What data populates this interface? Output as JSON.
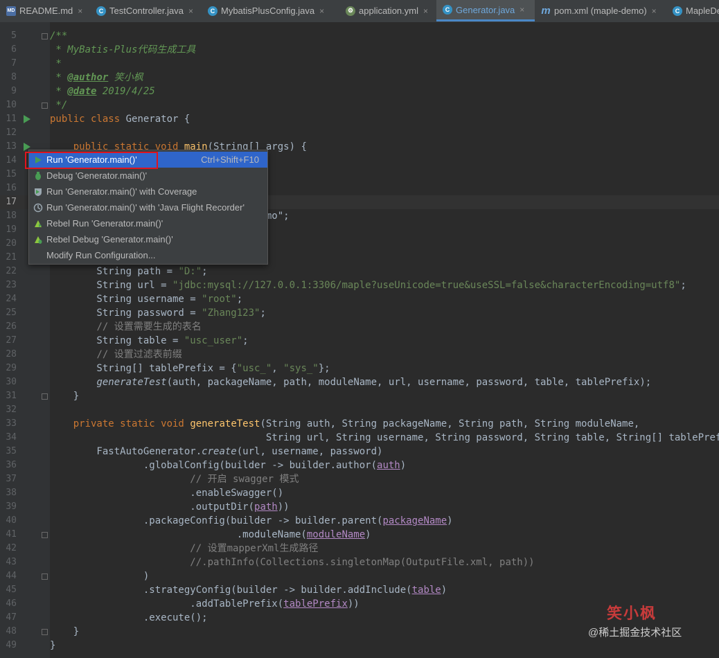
{
  "tabs": [
    {
      "label": "README.md",
      "icon": "markdown-file-icon",
      "active": false
    },
    {
      "label": "TestController.java",
      "icon": "java-class-icon",
      "active": false
    },
    {
      "label": "MybatisPlusConfig.java",
      "icon": "java-class-icon",
      "active": false
    },
    {
      "label": "application.yml",
      "icon": "yaml-file-icon",
      "active": false
    },
    {
      "label": "Generator.java",
      "icon": "java-class-icon",
      "active": true
    },
    {
      "label": "pom.xml (maple-demo)",
      "icon": "maven-file-icon",
      "active": false
    },
    {
      "label": "MapleDe",
      "icon": "java-class-icon",
      "active": false
    }
  ],
  "tab_close_glyph": "×",
  "editor": {
    "current_line": 17,
    "lines": [
      {
        "n": 5,
        "html": "<span class=\"doc\">/**</span>"
      },
      {
        "n": 6,
        "html": "<span class=\"doc\"> * MyBatis-Plus代码生成工具</span>"
      },
      {
        "n": 7,
        "html": "<span class=\"doc\"> *</span>"
      },
      {
        "n": 8,
        "html": "<span class=\"doc\"> * </span><span class=\"doctag\">@author</span><span class=\"doc\"> 笑小枫</span>"
      },
      {
        "n": 9,
        "html": "<span class=\"doc\"> * </span><span class=\"doctag\">@date</span><span class=\"doc\"> 2019/4/25</span>"
      },
      {
        "n": 10,
        "html": "<span class=\"doc\"> */</span>"
      },
      {
        "n": 11,
        "html": "<span class=\"kw\">public class</span> Generator {"
      },
      {
        "n": 12,
        "html": ""
      },
      {
        "n": 13,
        "html": "    <span class=\"kw\">public static void</span> <span class=\"fn\">main</span>(String[] args) {"
      },
      {
        "n": 14,
        "html": ""
      },
      {
        "n": 15,
        "html": ""
      },
      {
        "n": 16,
        "html": ""
      },
      {
        "n": 17,
        "html": ""
      },
      {
        "n": 18,
        "html": "                                  .demo\";"
      },
      {
        "n": 19,
        "html": ""
      },
      {
        "n": 20,
        "html": ""
      },
      {
        "n": 21,
        "html": "        <span class=\"cm\">// 指定输出目录</span>"
      },
      {
        "n": 22,
        "html": "        String path = <span class=\"str\">\"D:\"</span>;"
      },
      {
        "n": 23,
        "html": "        String url = <span class=\"str\">\"jdbc:mysql://127.0.0.1:3306/maple?useUnicode=true&amp;useSSL=false&amp;characterEncoding=utf8\"</span>;"
      },
      {
        "n": 24,
        "html": "        String username = <span class=\"str\">\"root\"</span>;"
      },
      {
        "n": 25,
        "html": "        String password = <span class=\"str\">\"Zhang123\"</span>;"
      },
      {
        "n": 26,
        "html": "        <span class=\"cm\">// 设置需要生成的表名</span>"
      },
      {
        "n": 27,
        "html": "        String table = <span class=\"str\">\"usc_user\"</span>;"
      },
      {
        "n": 28,
        "html": "        <span class=\"cm\">// 设置过滤表前缀</span>"
      },
      {
        "n": 29,
        "html": "        String[] tablePrefix = {<span class=\"str\">\"usc_\"</span>, <span class=\"str\">\"sys_\"</span>};"
      },
      {
        "n": 30,
        "html": "        <span class=\"it\">generateTest</span>(auth, packageName, path, moduleName, url, username, password, table, tablePrefix);"
      },
      {
        "n": 31,
        "html": "    }"
      },
      {
        "n": 32,
        "html": ""
      },
      {
        "n": 33,
        "html": "    <span class=\"kw\">private static void</span> <span class=\"fn\">generateTest</span>(String auth, String packageName, String path, String moduleName,"
      },
      {
        "n": 34,
        "html": "                                     String url, String username, String password, String table, String[] tablePrefix) {"
      },
      {
        "n": 35,
        "html": "        FastAutoGenerator.<span class=\"it\">create</span>(url, username, password)"
      },
      {
        "n": 36,
        "html": "                .globalConfig(builder -&gt; builder.author(<span class=\"param\">auth</span>)"
      },
      {
        "n": 37,
        "html": "                        <span class=\"cm\">// 开启 swagger 模式</span>"
      },
      {
        "n": 38,
        "html": "                        .enableSwagger()"
      },
      {
        "n": 39,
        "html": "                        .outputDir(<span class=\"param\">path</span>))"
      },
      {
        "n": 40,
        "html": "                .packageConfig(builder -&gt; builder.parent(<span class=\"param\">packageName</span>)"
      },
      {
        "n": 41,
        "html": "                                .moduleName(<span class=\"param\">moduleName</span>)"
      },
      {
        "n": 42,
        "html": "                        <span class=\"cm\">// 设置mapperXml生成路径</span>"
      },
      {
        "n": 43,
        "html": "                        <span class=\"cm\">//.pathInfo(Collections.singletonMap(OutputFile.xml, path))</span>"
      },
      {
        "n": 44,
        "html": "                )"
      },
      {
        "n": 45,
        "html": "                .strategyConfig(builder -&gt; builder.addInclude(<span class=\"param\">table</span>)"
      },
      {
        "n": 46,
        "html": "                        .addTablePrefix(<span class=\"param\">tablePrefix</span>))"
      },
      {
        "n": 47,
        "html": "                .execute();"
      },
      {
        "n": 48,
        "html": "    }"
      },
      {
        "n": 49,
        "html": "}"
      }
    ]
  },
  "popup": {
    "items": [
      {
        "label": "Run 'Generator.main()'",
        "shortcut": "Ctrl+Shift+F10",
        "icon": "run-icon",
        "selected": true
      },
      {
        "label": "Debug 'Generator.main()'",
        "shortcut": "",
        "icon": "debug-icon",
        "selected": false
      },
      {
        "label": "Run 'Generator.main()' with Coverage",
        "shortcut": "",
        "icon": "coverage-icon",
        "selected": false
      },
      {
        "label": "Run 'Generator.main()' with 'Java Flight Recorder'",
        "shortcut": "",
        "icon": "profiler-icon",
        "selected": false
      },
      {
        "label": "Rebel Run 'Generator.main()'",
        "shortcut": "",
        "icon": "jrebel-run-icon",
        "selected": false
      },
      {
        "label": "Rebel Debug 'Generator.main()'",
        "shortcut": "",
        "icon": "jrebel-debug-icon",
        "selected": false
      },
      {
        "label": "Modify Run Configuration...",
        "shortcut": "",
        "icon": "",
        "selected": false
      }
    ]
  },
  "watermark": {
    "logo": "笑小枫",
    "text": "@稀土掘金技术社区"
  },
  "colors": {
    "accent": "#4a88c7",
    "selection": "#2f65ca",
    "highlight_box": "#e0141e",
    "run_green": "#499c54"
  }
}
